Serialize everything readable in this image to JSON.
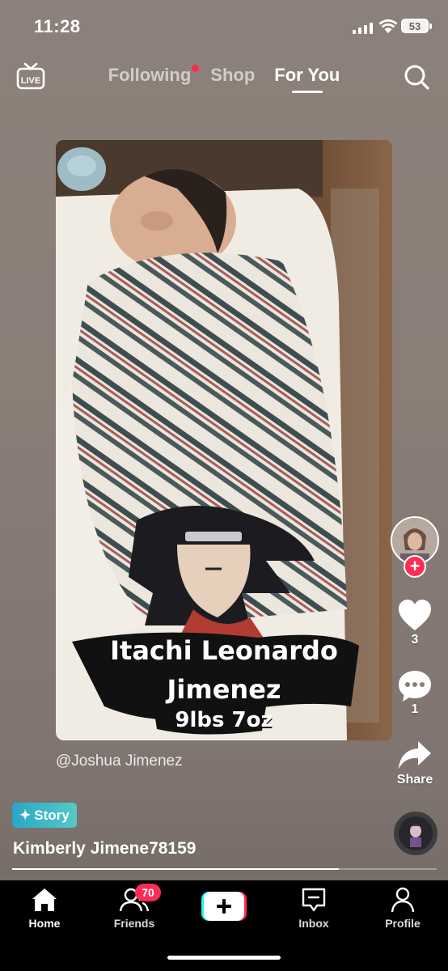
{
  "status_bar": {
    "time": "11:28",
    "battery": "53",
    "icons": [
      "cellular-signal-icon",
      "wifi-icon",
      "battery-icon"
    ]
  },
  "top_nav": {
    "live_label": "LIVE",
    "tabs": [
      {
        "label": "Following",
        "notification_dot": true
      },
      {
        "label": "Shop"
      },
      {
        "label": "For You",
        "active": true
      }
    ],
    "search_icon": "search-icon"
  },
  "video": {
    "overlay_text": {
      "line1": "Itachi Leonardo",
      "line2": "Jimenez",
      "line3": "9lbs 7oz"
    },
    "author_handle": "@Joshua Jimenez"
  },
  "actions": {
    "likes": "3",
    "comments": "1",
    "share_label": "Share"
  },
  "story_badge": "Story",
  "username": "Kimberly Jimene78159",
  "playback_progress": 0.77,
  "bottom_nav": {
    "items": [
      {
        "label": "Home",
        "icon": "home-icon",
        "active": true
      },
      {
        "label": "Friends",
        "icon": "friends-icon",
        "badge": "70"
      },
      {
        "label": "",
        "icon": "create-plus-icon"
      },
      {
        "label": "Inbox",
        "icon": "inbox-icon"
      },
      {
        "label": "Profile",
        "icon": "profile-icon"
      }
    ]
  },
  "colors": {
    "accent": "#fe2c55",
    "story_chip": "#3bb8c7",
    "nav_background": "#000000"
  }
}
